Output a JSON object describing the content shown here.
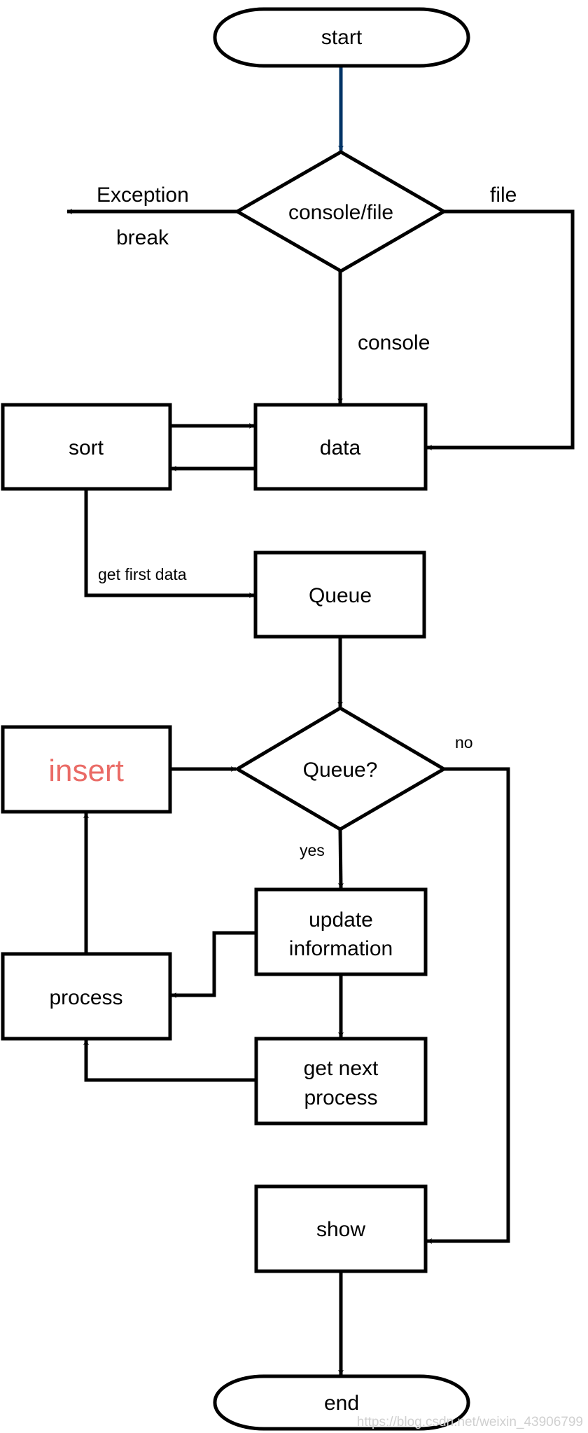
{
  "nodes": {
    "start": "start",
    "decision_input": "console/file",
    "data": "data",
    "sort": "sort",
    "queue": "Queue",
    "decision_queue": "Queue?",
    "insert": "insert",
    "update_line1": "update",
    "update_line2": "information",
    "process": "process",
    "get_next_line1": "get next",
    "get_next_line2": "process",
    "show": "show",
    "end": "end"
  },
  "edge_labels": {
    "exception": "Exception",
    "break": "break",
    "file": "file",
    "console": "console",
    "get_first_data": "get first data",
    "no": "no",
    "yes": "yes"
  },
  "colors": {
    "insert_text": "#ea6b66",
    "start_arrow": "#003366",
    "stroke": "#000000"
  },
  "watermark": "https://blog.csdn.net/weixin_43906799"
}
